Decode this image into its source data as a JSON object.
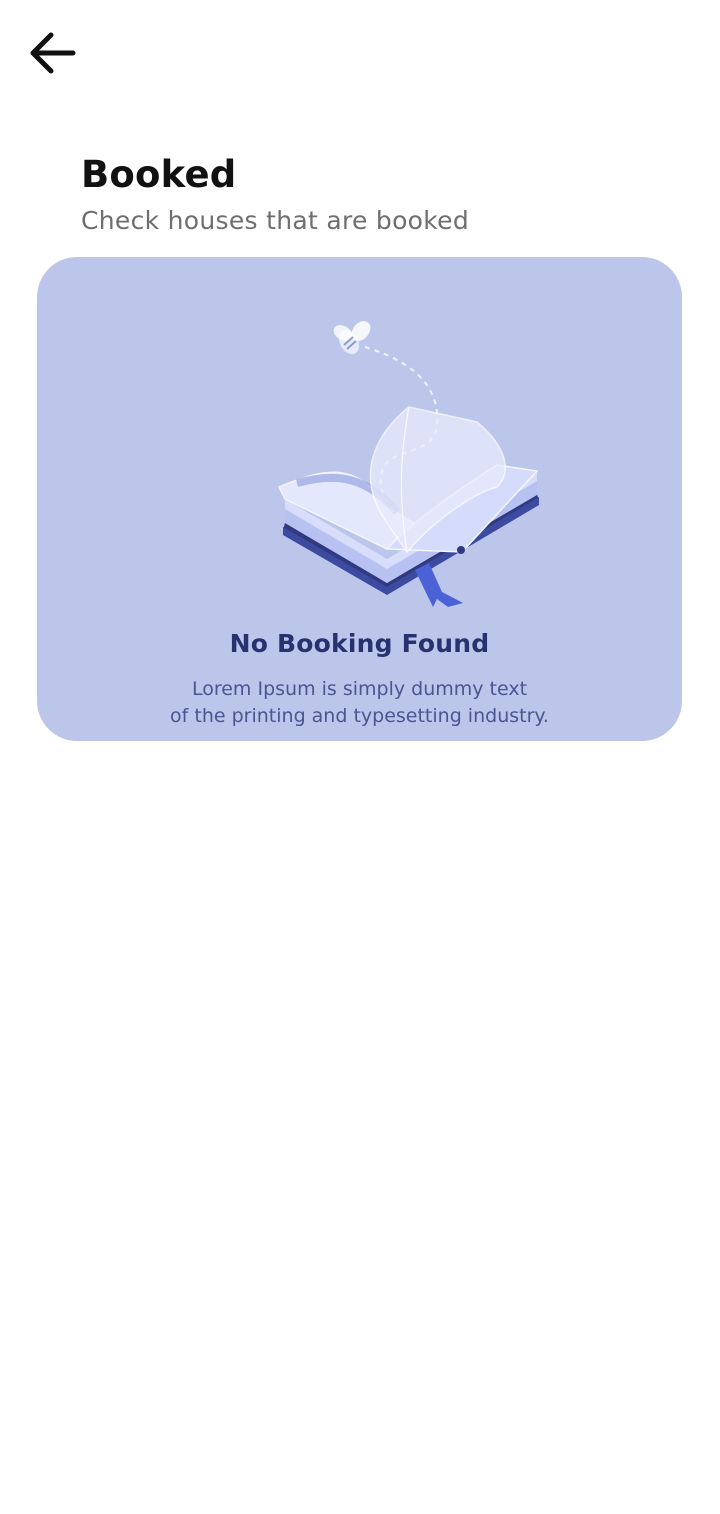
{
  "header": {
    "title": "Booked",
    "subtitle": "Check houses that are booked"
  },
  "empty_state": {
    "title": "No Booking Found",
    "description_line1": "Lorem Ipsum is simply dummy text",
    "description_line2": "of the printing and typesetting industry.",
    "illustration_icon": "open-book-illustration"
  },
  "icons": {
    "back": "arrow-left-icon"
  },
  "colors": {
    "card_background": "#bcc6ea",
    "title_text": "#111111",
    "subtitle_text": "#6e6e6e",
    "empty_title": "#27336f",
    "empty_description": "#4a5592",
    "bookmark": "#4b62d6"
  }
}
